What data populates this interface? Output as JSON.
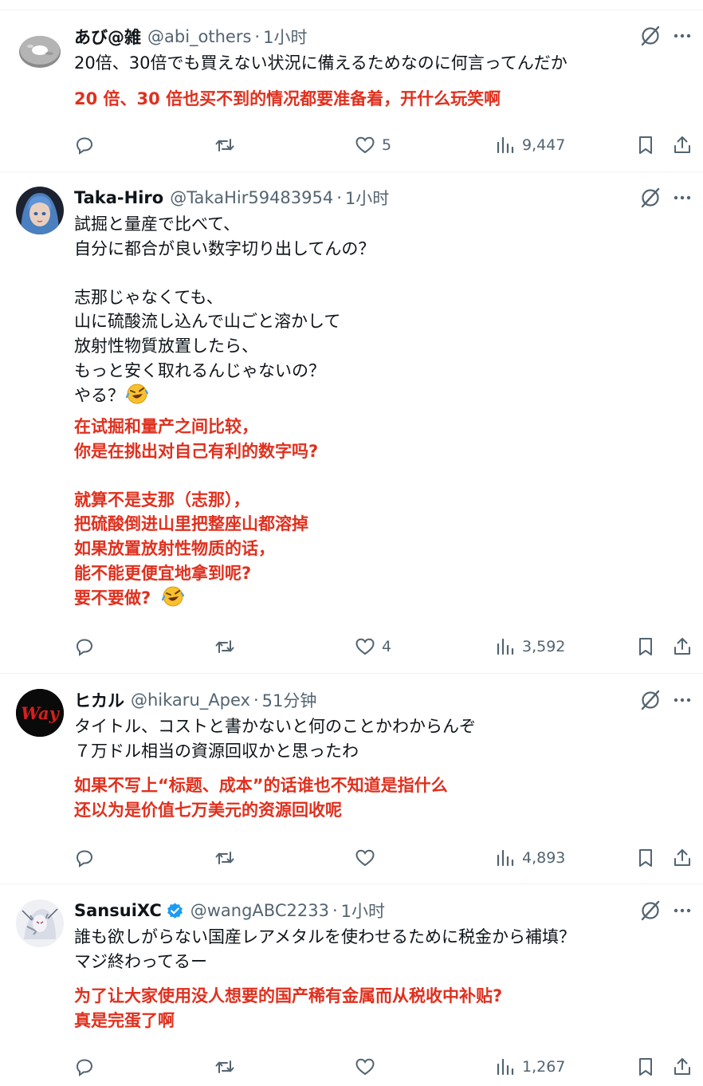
{
  "posts": [
    {
      "name": "あび@雑",
      "handle": "@abi_others",
      "time": "1小时",
      "lines": [
        "20倍、30倍でも買えない状況に備えるためなのに何言ってんだか"
      ],
      "translation": [
        "20 倍、30 倍也买不到的情况都要准备着，开什么玩笑啊"
      ],
      "likes": "5",
      "views": "9,447"
    },
    {
      "name": "Taka-Hiro",
      "handle": "@TakaHir59483954",
      "time": "1小时",
      "lines": [
        "試掘と量産で比べて、",
        "自分に都合が良い数字切り出してんの？",
        "",
        "志那じゃなくても、",
        "山に硫酸流し込んで山ごと溶かして",
        "放射性物質放置したら、",
        "もっと安く取れるんじゃないの？",
        "やる？"
      ],
      "translation": [
        "在试掘和量产之间比较，",
        "你是在挑出对自己有利的数字吗?",
        "",
        "就算不是支那（志那），",
        "把硫酸倒进山里把整座山都溶掉",
        "如果放置放射性物质的话，",
        "能不能更便宜地拿到呢?",
        "要不要做?"
      ],
      "likes": "4",
      "views": "3,592"
    },
    {
      "name": "ヒカル",
      "handle": "@hikaru_Apex",
      "time": "51分钟",
      "avatar_text": "Way",
      "lines": [
        "タイトル、コストと書かないと何のことかわからんぞ",
        "７万ドル相当の資源回収かと思ったわ"
      ],
      "translation": [
        "如果不写上“标题、成本”的话谁也不知道是指什么",
        "还以为是价值七万美元的资源回收呢"
      ],
      "likes": "",
      "views": "4,893"
    },
    {
      "name": "SansuiXC",
      "handle": "@wangABC2233",
      "time": "1小时",
      "lines": [
        "誰も欲しがらない国産レアメタルを使わせるために税金から補填？",
        "マジ終わってるー"
      ],
      "translation": [
        "为了让大家使用没人想要的国产稀有金属而从税收中补贴?",
        "真是完蛋了啊"
      ],
      "likes": "",
      "views": "1,267"
    }
  ],
  "icons": {
    "header": [
      "grok-icon",
      "more-icon"
    ],
    "actions": [
      "reply-icon",
      "retweet-icon",
      "like-icon",
      "views-icon",
      "bookmark-icon",
      "share-icon"
    ],
    "emoji": "rolling-on-floor-laughing-emoji",
    "verified": "verified-badge-icon"
  },
  "colors": {
    "translation": "#e0301e",
    "secondary": "#536471",
    "verified": "#1d9bf0",
    "divider": "#eff3f4"
  }
}
